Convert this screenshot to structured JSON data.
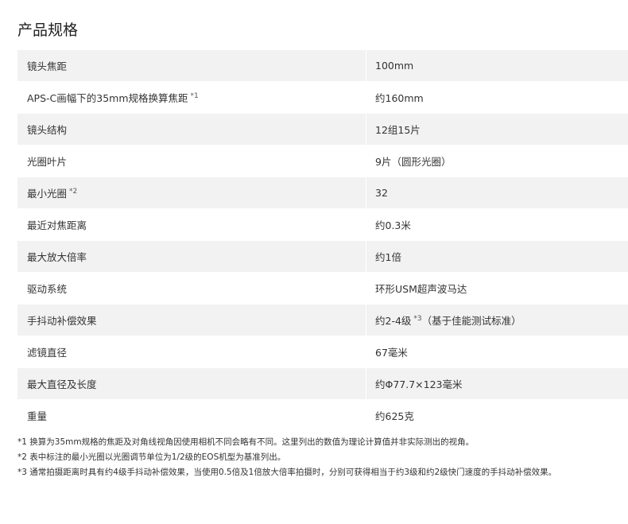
{
  "title": "产品规格",
  "specs": [
    {
      "label": "镜头焦距",
      "note": "",
      "value": "100mm",
      "value_note": "",
      "value_tail": ""
    },
    {
      "label": "APS-C画幅下的35mm规格换算焦距",
      "note": "*1",
      "value": "约160mm",
      "value_note": "",
      "value_tail": ""
    },
    {
      "label": "镜头结构",
      "note": "",
      "value": "12组15片",
      "value_note": "",
      "value_tail": ""
    },
    {
      "label": "光圈叶片",
      "note": "",
      "value": "9片（圆形光圈）",
      "value_note": "",
      "value_tail": ""
    },
    {
      "label": "最小光圈",
      "note": "*2",
      "value": "32",
      "value_note": "",
      "value_tail": ""
    },
    {
      "label": "最近对焦距离",
      "note": "",
      "value": "约0.3米",
      "value_note": "",
      "value_tail": ""
    },
    {
      "label": "最大放大倍率",
      "note": "",
      "value": "约1倍",
      "value_note": "",
      "value_tail": ""
    },
    {
      "label": "驱动系统",
      "note": "",
      "value": "环形USM超声波马达",
      "value_note": "",
      "value_tail": ""
    },
    {
      "label": "手抖动补偿效果",
      "note": "",
      "value": "约2-4级",
      "value_note": "*3",
      "value_tail": "（基于佳能测试标准）"
    },
    {
      "label": "滤镜直径",
      "note": "",
      "value": "67毫米",
      "value_note": "",
      "value_tail": ""
    },
    {
      "label": "最大直径及长度",
      "note": "",
      "value": "约Φ77.7×123毫米",
      "value_note": "",
      "value_tail": ""
    },
    {
      "label": "重量",
      "note": "",
      "value": "约625克",
      "value_note": "",
      "value_tail": ""
    }
  ],
  "footnotes": [
    "*1 换算为35mm规格的焦距及对角线视角因使用相机不同会略有不同。这里列出的数值为理论计算值并非实际测出的视角。",
    "*2 表中标注的最小光圈以光圈调节单位为1/2级的EOS机型为基准列出。",
    "*3 通常拍摄距离时具有约4级手抖动补偿效果，当使用0.5倍及1倍放大倍率拍摄时，分别可获得相当于约3级和约2级快门速度的手抖动补偿效果。"
  ]
}
